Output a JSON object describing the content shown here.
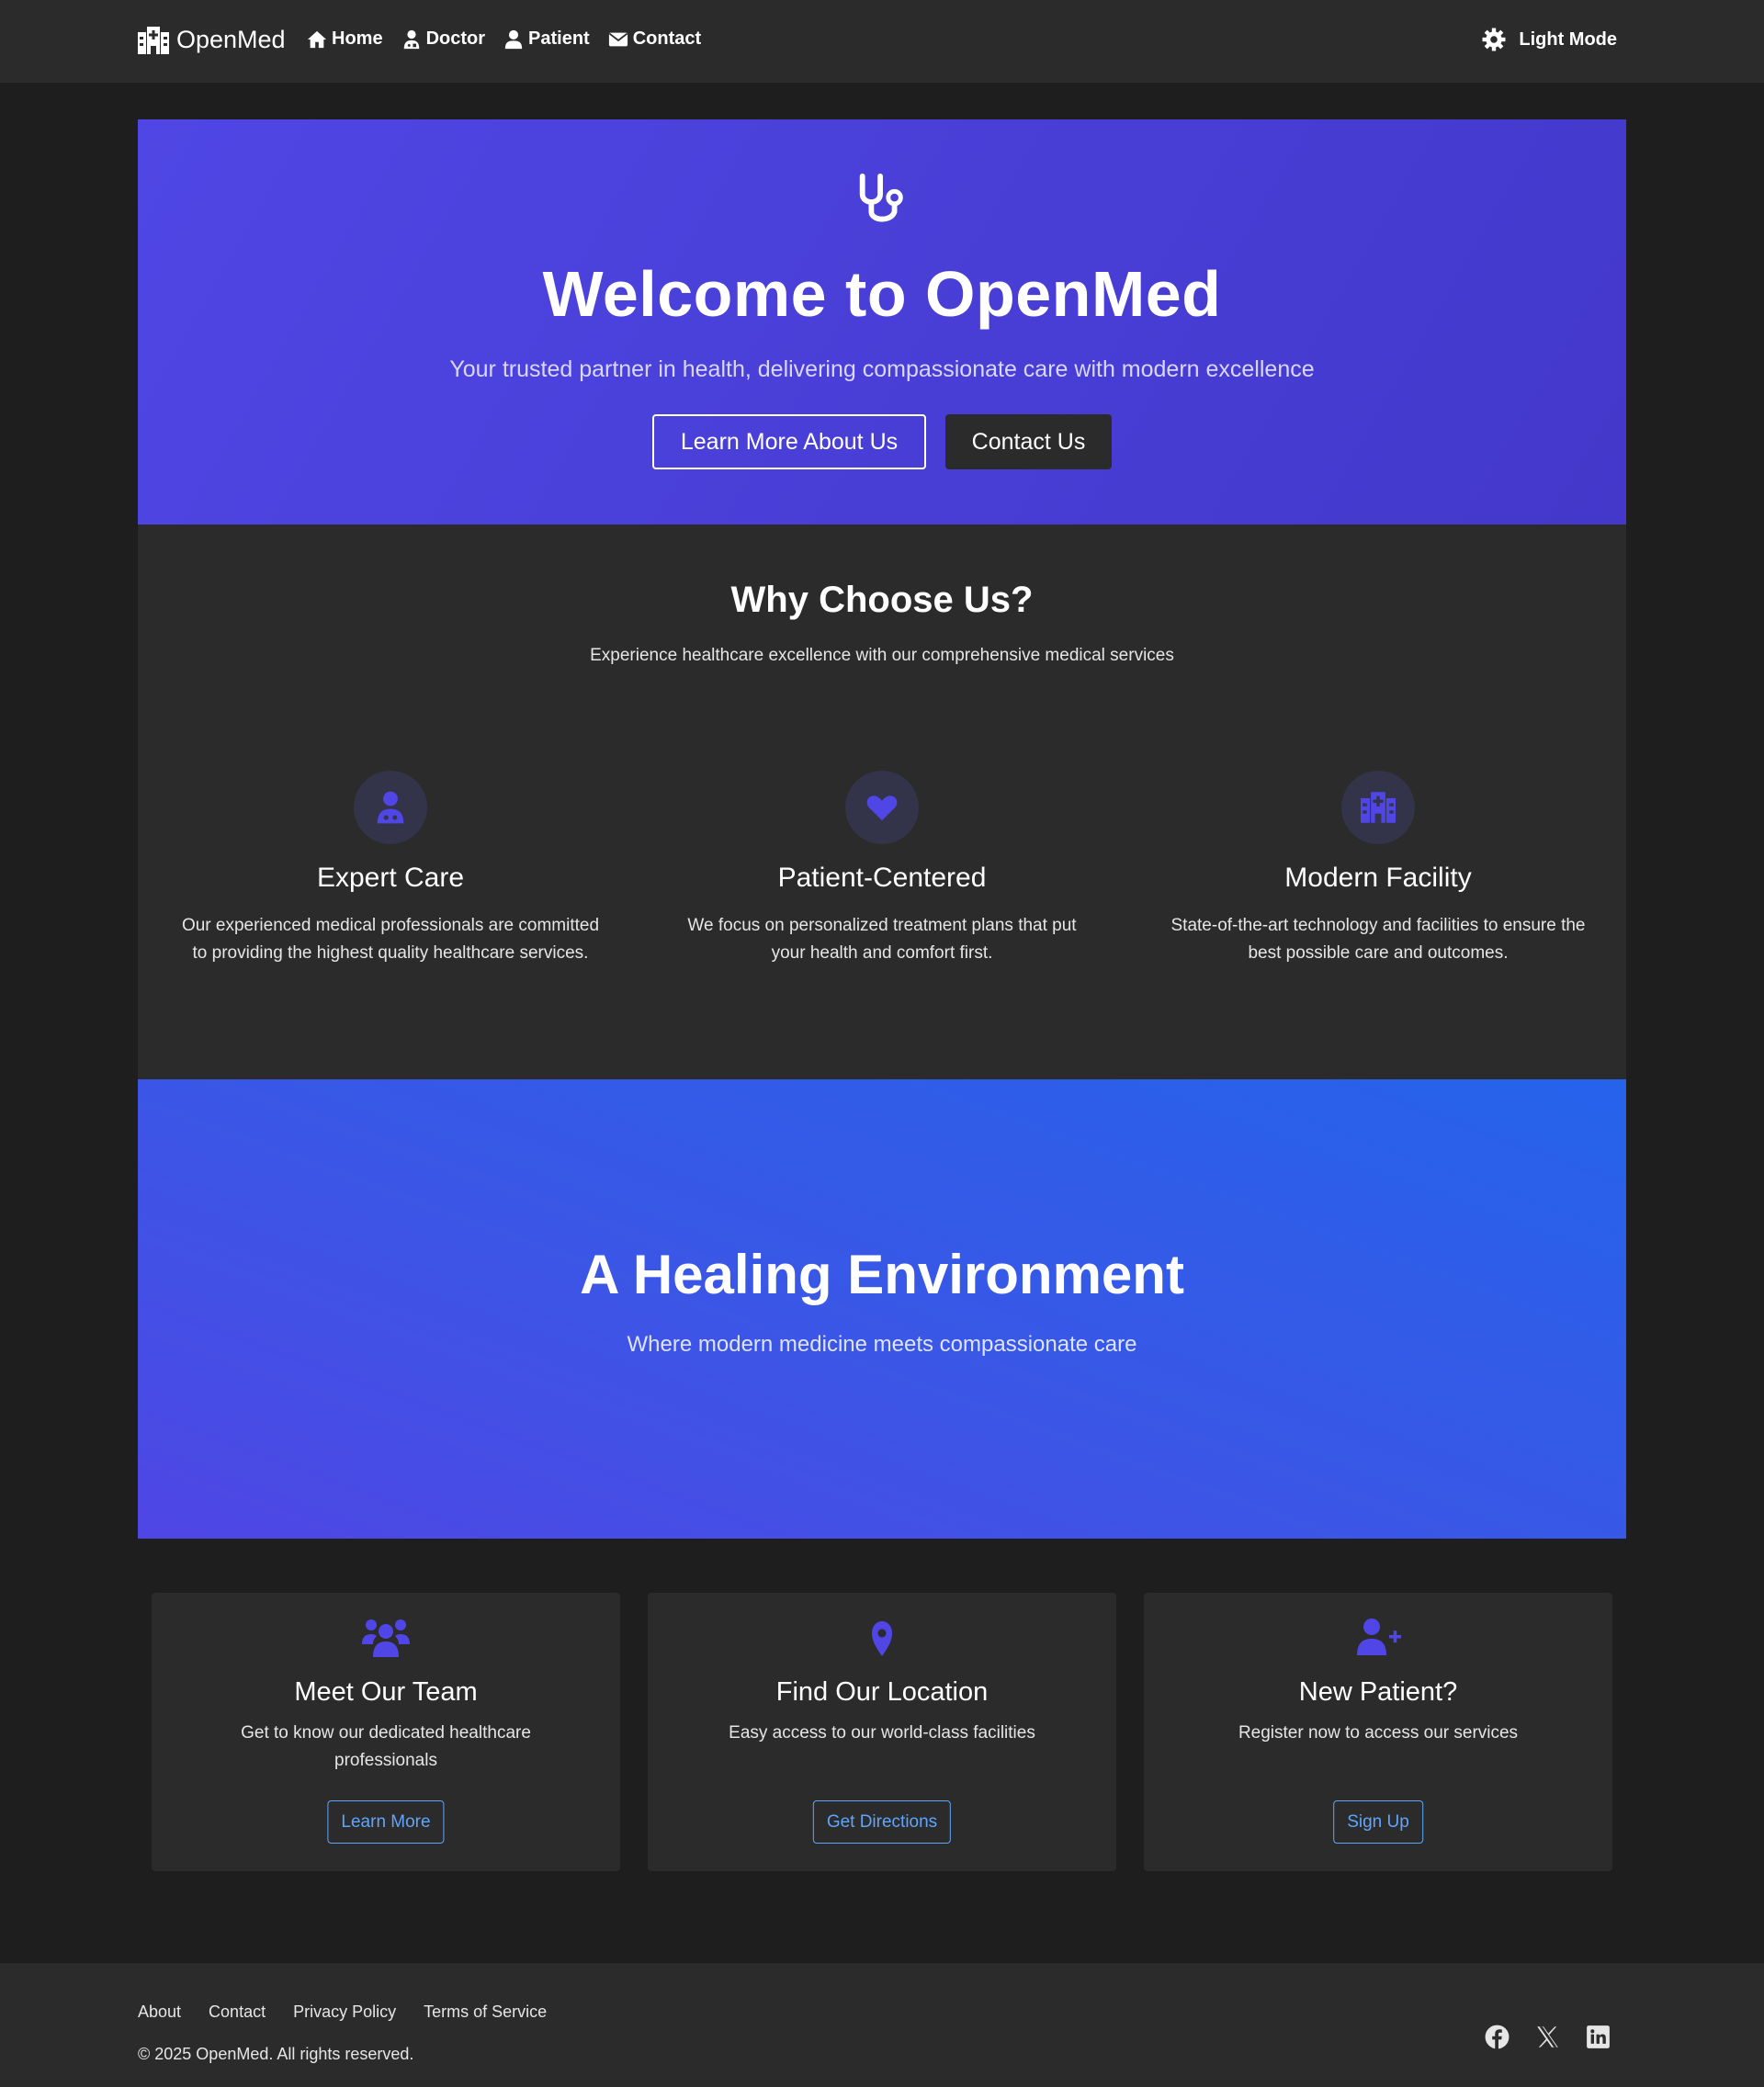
{
  "nav": {
    "brand": "OpenMed",
    "links": [
      {
        "label": "Home",
        "icon": "home-icon"
      },
      {
        "label": "Doctor",
        "icon": "doctor-icon"
      },
      {
        "label": "Patient",
        "icon": "user-icon"
      },
      {
        "label": "Contact",
        "icon": "envelope-icon"
      }
    ],
    "theme_toggle": "Light Mode"
  },
  "hero": {
    "icon": "stethoscope-icon",
    "title": "Welcome to OpenMed",
    "subtitle": "Your trusted partner in health, delivering compassionate care with modern excellence",
    "primary_button": "Learn More About Us",
    "secondary_button": "Contact Us"
  },
  "features": {
    "title": "Why Choose Us?",
    "subtitle": "Experience healthcare excellence with our comprehensive medical services",
    "items": [
      {
        "icon": "doctor-icon",
        "title": "Expert Care",
        "description": "Our experienced medical professionals are committed to providing the highest quality healthcare services."
      },
      {
        "icon": "heart-icon",
        "title": "Patient-Centered",
        "description": "We focus on personalized treatment plans that put your health and comfort first."
      },
      {
        "icon": "hospital-icon",
        "title": "Modern Facility",
        "description": "State-of-the-art technology and facilities to ensure the best possible care and outcomes."
      }
    ]
  },
  "banner": {
    "title": "A Healing Environment",
    "subtitle": "Where modern medicine meets compassionate care"
  },
  "cards": [
    {
      "icon": "users-icon",
      "title": "Meet Our Team",
      "description": "Get to know our dedicated healthcare professionals",
      "button": "Learn More"
    },
    {
      "icon": "map-pin-icon",
      "title": "Find Our Location",
      "description": "Easy access to our world-class facilities",
      "button": "Get Directions"
    },
    {
      "icon": "user-plus-icon",
      "title": "New Patient?",
      "description": "Register now to access our services",
      "button": "Sign Up"
    }
  ],
  "footer": {
    "links": [
      "About",
      "Contact",
      "Privacy Policy",
      "Terms of Service"
    ],
    "copyright": "© 2025 OpenMed. All rights reserved.",
    "social": [
      "facebook-icon",
      "x-icon",
      "linkedin-icon"
    ]
  },
  "colors": {
    "accent": "#4f46e5",
    "accent_blue": "#2563eb",
    "link_blue": "#60a5fa",
    "surface": "#2b2b2b",
    "background": "#1e1e1e"
  }
}
